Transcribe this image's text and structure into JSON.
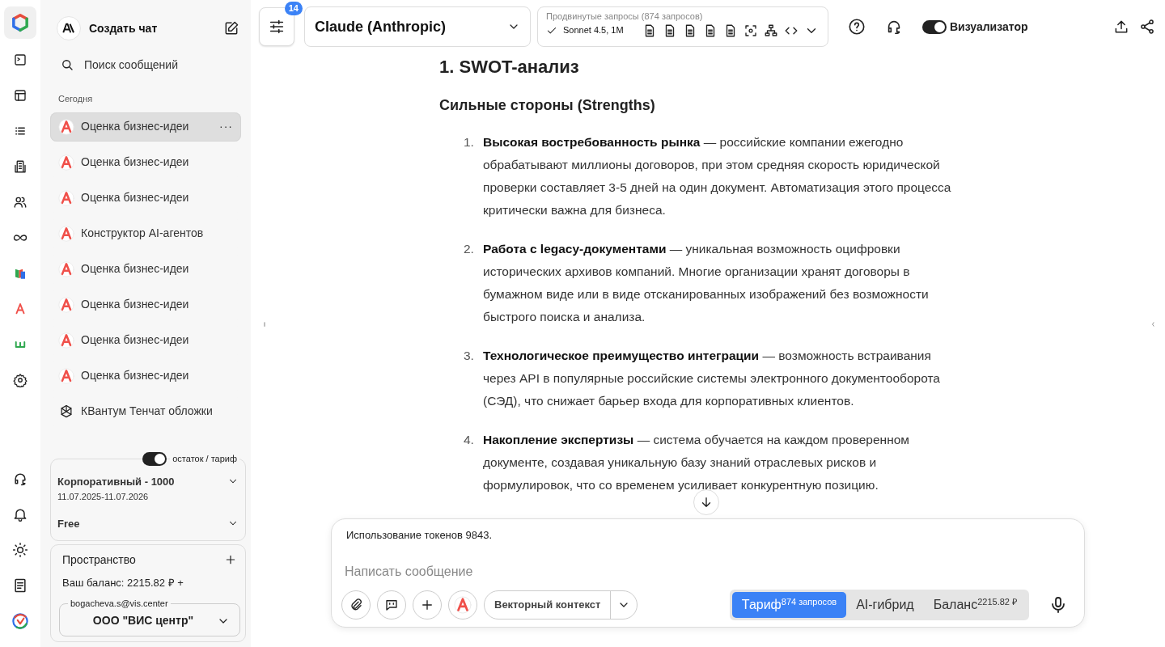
{
  "sidebar": {
    "new_chat": "Создать чат",
    "search": {
      "placeholder": "Поиск сообщений"
    },
    "section": "Сегодня",
    "chats": [
      {
        "kind": "letter-a",
        "title": "Оценка бизнес-идеи",
        "selected": true,
        "more": "···"
      },
      {
        "kind": "letter-a",
        "title": "Оценка бизнес-идеи",
        "selected": false
      },
      {
        "kind": "letter-a",
        "title": "Оценка бизнес-идеи",
        "selected": false
      },
      {
        "kind": "letter-a",
        "title": "Конструктор AI-агентов",
        "selected": false
      },
      {
        "kind": "letter-a",
        "title": "Оценка бизнес-идеи",
        "selected": false
      },
      {
        "kind": "letter-a",
        "title": "Оценка бизнес-идеи",
        "selected": false
      },
      {
        "kind": "letter-a",
        "title": "Оценка бизнес-идеи",
        "selected": false
      },
      {
        "kind": "letter-a",
        "title": "Оценка бизнес-идеи",
        "selected": false
      },
      {
        "kind": "openai",
        "title": "КВантум Тенчат обложки",
        "selected": false
      }
    ],
    "plan_toggle": {
      "label": "остаток / тариф",
      "on": true
    },
    "plans": [
      {
        "name": "Корпоративный - 1000",
        "period": "11.07.2025-11.07.2026"
      },
      {
        "name": "Free"
      }
    ],
    "space": {
      "title": "Пространство",
      "balance": "Ваш баланс: 2215.82 ₽ +",
      "account": "bogacheva.s@vis.center",
      "organization": "ООО \"ВИС центр\""
    }
  },
  "toolbar": {
    "settings_badge": "14",
    "model": "Claude (Anthropic)",
    "advanced": {
      "label": "Продвинутые запросы (874 запросов)",
      "version": "Sonnet 4.5, 1M"
    },
    "visualizer": {
      "label": "Визуализатор",
      "on": true
    }
  },
  "document": {
    "heading": "1. SWOT-анализ",
    "subheading": "Сильные стороны (Strengths)",
    "items": [
      {
        "number": "1.",
        "text": "**Высокая востребованность рынка** — российские компании ежегодно обрабатывают миллионы договоров, при этом средняя скорость юридической проверки составляет 3-5 дней на один документ. Автоматизация этого процесса критически важна для бизнеса."
      },
      {
        "number": "2.",
        "text": "**Работа с legacy-документами** — уникальная возможность оцифровки исторических архивов компаний. Многие организации хранят договоры в бумажном виде или в виде отсканированных изображений без возможности быстрого поиска и анализа."
      },
      {
        "number": "3.",
        "text": "**Технологическое преимущество интеграции** — возможность встраивания через API в популярные российские системы электронного документооборота (СЭД), что снижает барьер входа для корпоративных клиентов."
      },
      {
        "number": "4.",
        "text": "**Накопление экспертизы** — система обучается на каждом проверенном документе, создавая уникальную базу знаний отраслевых рисков и формулировок, что со временем усиливает конкурентную позицию."
      }
    ]
  },
  "composer": {
    "usage": "Использование токенов 9843.",
    "placeholder": "Написать сообщение",
    "context": "Векторный контекст",
    "modes": [
      {
        "label": "Тариф$^{874 запросов}$",
        "selected": true
      },
      {
        "label": "AI-гибрид",
        "selected": false
      },
      {
        "label": "Баланс$^{2215.82 ₽}$",
        "selected": false
      }
    ]
  }
}
